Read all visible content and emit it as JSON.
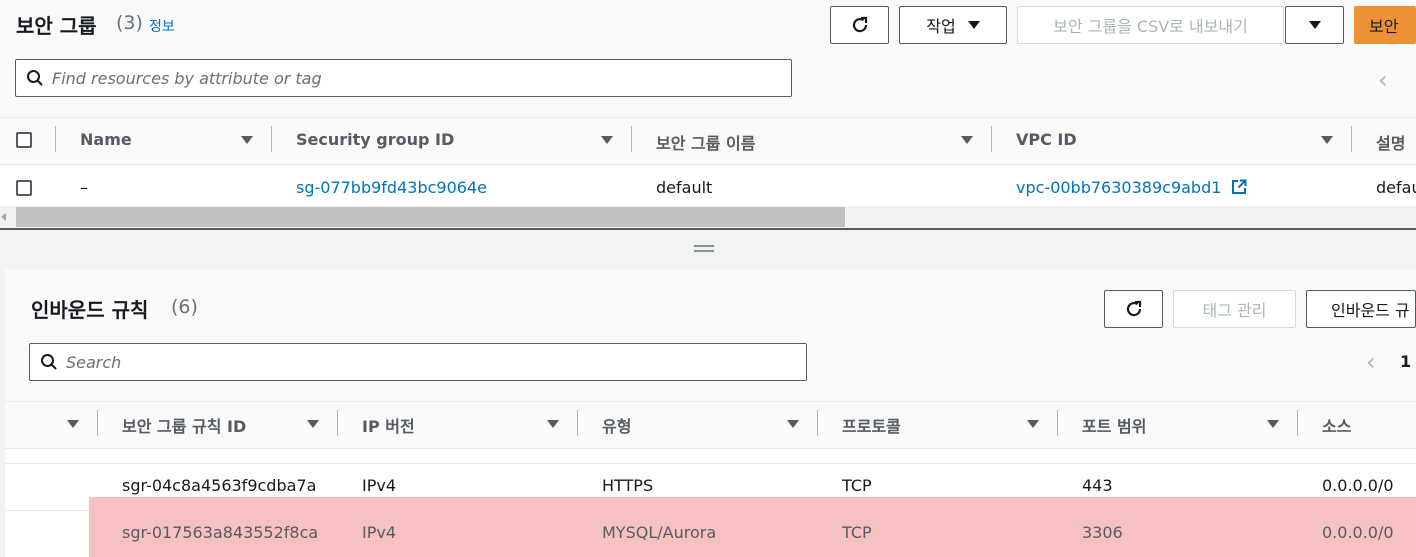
{
  "top": {
    "title": "보안 그룹",
    "count": "(3)",
    "info": "정보",
    "refresh_icon": "refresh-icon",
    "actions_label": "작업",
    "export_label": "보안 그룹을 CSV로 내보내기",
    "create_label": "보안",
    "search_placeholder": "Find resources by attribute or tag",
    "columns": [
      "Name",
      "Security group ID",
      "보안 그룹 이름",
      "VPC ID",
      "설명"
    ],
    "rows": [
      {
        "name": "–",
        "sg_id": "sg-077bb9fd43bc9064e",
        "sg_name": "default",
        "vpc_id": "vpc-00bb7630389c9abd1",
        "desc": "default"
      }
    ]
  },
  "bottom": {
    "title": "인바운드 규칙",
    "count": "(6)",
    "manage_tags_label": "태그 관리",
    "edit_rules_label": "인바운드 규",
    "search_placeholder": "Search",
    "page_number": "1",
    "columns": [
      "보안 그룹 규칙 ID",
      "IP 버전",
      "유형",
      "프로토콜",
      "포트 범위",
      "소스"
    ],
    "rows": [
      {
        "rule_id": "sgr-04c8a4563f9cdba7a",
        "ip": "IPv4",
        "type": "HTTPS",
        "protocol": "TCP",
        "port": "443",
        "source": "0.0.0.0/0"
      },
      {
        "rule_id": "sgr-017563a843552f8ca",
        "ip": "IPv4",
        "type": "MYSQL/Aurora",
        "protocol": "TCP",
        "port": "3306",
        "source": "0.0.0.0/0"
      }
    ],
    "highlight_color": "#f8c1c1"
  }
}
